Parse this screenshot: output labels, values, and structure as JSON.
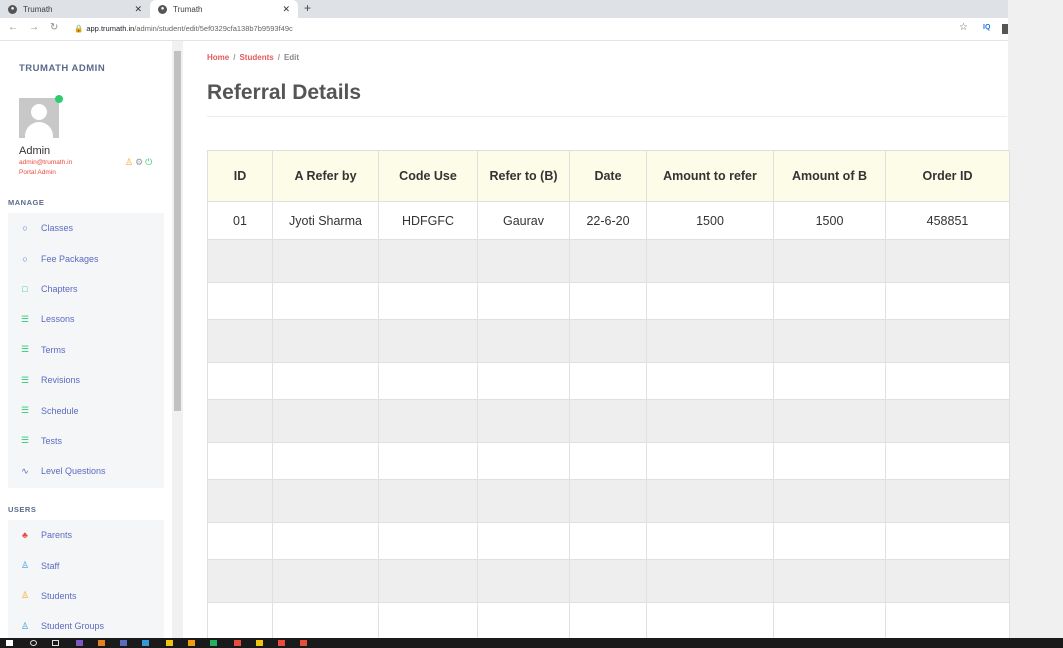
{
  "browser": {
    "tabs": [
      {
        "label": "Trumath"
      },
      {
        "label": "Trumath"
      }
    ],
    "url_host": "app.trumath.in",
    "url_path": "/admin/student/edit/5ef0329cfa138b7b9593f49c",
    "ext_label": "IQ"
  },
  "sidebar": {
    "brand": "TRUMATH ADMIN",
    "user": {
      "name": "Admin",
      "email": "admin@trumath.in",
      "role": "Portal Admin"
    },
    "manage_title": "MANAGE",
    "manage_items": [
      {
        "label": "Classes",
        "icon": "circle-icon",
        "color": "#4a6ee0"
      },
      {
        "label": "Fee Packages",
        "icon": "circle-icon",
        "color": "#4a6ee0"
      },
      {
        "label": "Chapters",
        "icon": "square-icon",
        "color": "#2ecc71"
      },
      {
        "label": "Lessons",
        "icon": "list-icon",
        "color": "#2ecc71"
      },
      {
        "label": "Terms",
        "icon": "list-icon",
        "color": "#2ecc71"
      },
      {
        "label": "Revisions",
        "icon": "list-icon",
        "color": "#2ecc71"
      },
      {
        "label": "Schedule",
        "icon": "list-icon",
        "color": "#2ecc71"
      },
      {
        "label": "Tests",
        "icon": "list-icon",
        "color": "#2ecc71"
      },
      {
        "label": "Level Questions",
        "icon": "pulse-icon",
        "color": "#5c6bc0"
      }
    ],
    "users_title": "USERS",
    "users_items": [
      {
        "label": "Parents",
        "icon": "group-icon",
        "color": "#e74c3c"
      },
      {
        "label": "Staff",
        "icon": "user-icon",
        "color": "#3498db"
      },
      {
        "label": "Students",
        "icon": "user-icon",
        "color": "#f5a623"
      },
      {
        "label": "Student Groups",
        "icon": "user-icon",
        "color": "#3498db"
      }
    ]
  },
  "breadcrumb": {
    "home": "Home",
    "students": "Students",
    "current": "Edit",
    "sep": "/"
  },
  "page_title": "Referral  Details",
  "table": {
    "columns": [
      "ID",
      "A Refer by",
      "Code Use",
      "Refer to (B)",
      "Date",
      "Amount to refer",
      "Amount of B",
      "Order ID"
    ],
    "rows": [
      [
        "01",
        "Jyoti Sharma",
        "HDFGFC",
        "Gaurav",
        "22-6-20",
        "1500",
        "1500",
        "458851"
      ]
    ],
    "empty_rows": 10
  }
}
